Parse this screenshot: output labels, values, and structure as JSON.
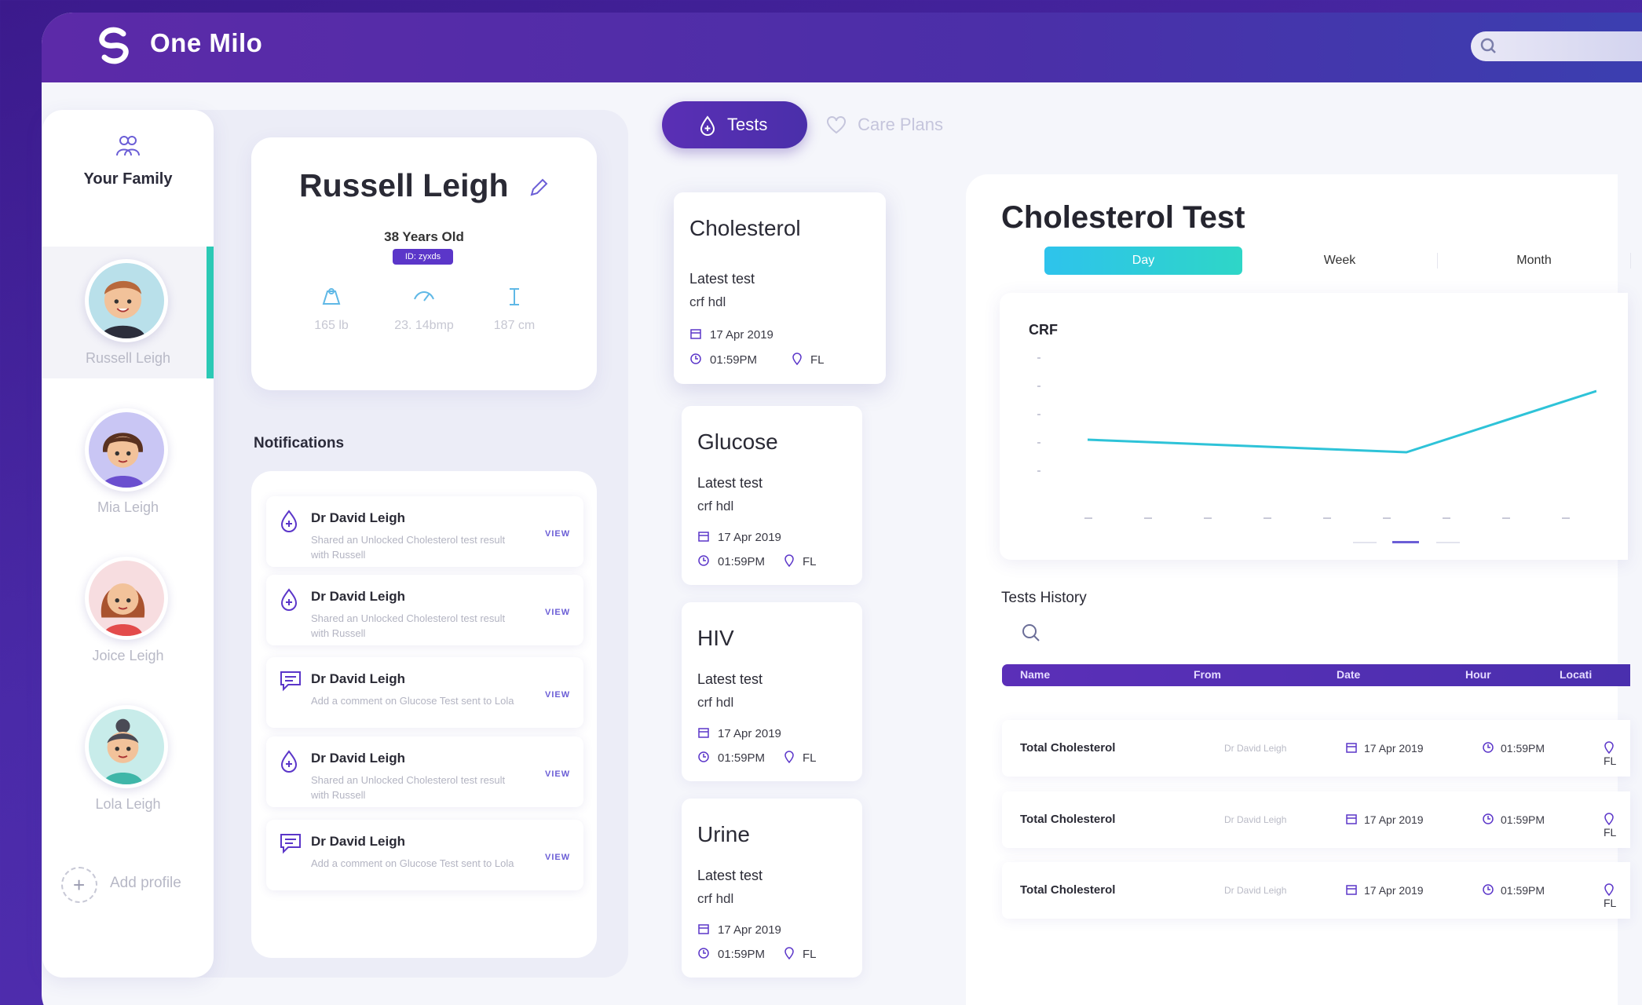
{
  "app": {
    "title": "One Milo"
  },
  "family": {
    "title": "Your Family",
    "members": [
      {
        "name": "Russell Leigh",
        "active": true
      },
      {
        "name": "Mia Leigh"
      },
      {
        "name": "Joice Leigh"
      },
      {
        "name": "Lola Leigh"
      }
    ],
    "add_label": "Add profile"
  },
  "profile": {
    "name": "Russell Leigh",
    "age": "38 Years Old",
    "id_badge": "ID: zyxds",
    "stats": [
      {
        "icon": "weight-icon",
        "value": "165 lb"
      },
      {
        "icon": "heart-rate-icon",
        "value": "23. 14bmp"
      },
      {
        "icon": "height-icon",
        "value": "187 cm"
      }
    ]
  },
  "notifications": {
    "title": "Notifications",
    "items": [
      {
        "icon": "drop-icon",
        "from": "Dr David Leigh",
        "message": "Shared an Unlocked Cholesterol test result with Russell",
        "action": "VIEW"
      },
      {
        "icon": "drop-icon",
        "from": "Dr David Leigh",
        "message": "Shared an Unlocked Cholesterol test result with Russell",
        "action": "VIEW"
      },
      {
        "icon": "comment-icon",
        "from": "Dr David Leigh",
        "message": "Add a comment on Glucose Test sent to Lola",
        "action": "VIEW"
      },
      {
        "icon": "drop-icon",
        "from": "Dr David Leigh",
        "message": "Shared an Unlocked Cholesterol test result with Russell",
        "action": "VIEW"
      },
      {
        "icon": "comment-icon",
        "from": "Dr David Leigh",
        "message": "Add a comment on Glucose Test sent to Lola",
        "action": "VIEW"
      }
    ]
  },
  "tabs": {
    "tests": "Tests",
    "care_plans": "Care Plans"
  },
  "tests": [
    {
      "title": "Cholesterol",
      "latest": "Latest test",
      "sub": "crf hdl",
      "date": "17 Apr 2019",
      "hour": "01:59PM",
      "location": "FL",
      "selected": true
    },
    {
      "title": "Glucose",
      "latest": "Latest test",
      "sub": "crf hdl",
      "date": "17 Apr 2019",
      "hour": "01:59PM",
      "location": "FL"
    },
    {
      "title": "HIV",
      "latest": "Latest test",
      "sub": "crf hdl",
      "date": "17 Apr 2019",
      "hour": "01:59PM",
      "location": "FL"
    },
    {
      "title": "Urine",
      "latest": "Latest test",
      "sub": "crf hdl",
      "date": "17 Apr 2019",
      "hour": "01:59PM",
      "location": "FL"
    }
  ],
  "detail": {
    "title": "Cholesterol Test",
    "periods": [
      "Day",
      "Week",
      "Month"
    ],
    "active_period": "Day",
    "chart_label": "CRF",
    "history_title": "Tests History",
    "columns": [
      "Name",
      "From",
      "Date",
      "Hour",
      "Locati"
    ],
    "rows": [
      {
        "name": "Total Cholesterol",
        "from": "Dr David Leigh",
        "date": "17 Apr 2019",
        "hour": "01:59PM",
        "location": "FL"
      },
      {
        "name": "Total Cholesterol",
        "from": "Dr David Leigh",
        "date": "17 Apr 2019",
        "hour": "01:59PM",
        "location": "FL"
      },
      {
        "name": "Total Cholesterol",
        "from": "Dr David Leigh",
        "date": "17 Apr 2019",
        "hour": "01:59PM",
        "location": "FL"
      }
    ]
  },
  "colors": {
    "brand": "#5b2fb8",
    "accent": "#2ed6c7",
    "line": "#2ec3d8"
  }
}
